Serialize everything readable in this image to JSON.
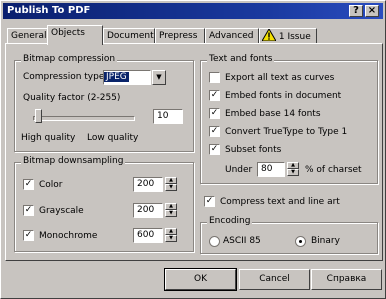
{
  "window": {
    "title": "Publish To PDF",
    "help_glyph": "?",
    "close_glyph": "×"
  },
  "tabs": [
    "General",
    "Objects",
    "Document",
    "Prepress",
    "Advanced",
    "1 Issue"
  ],
  "bitmap_compression": {
    "title": "Bitmap compression",
    "compression_type_label": "Compression type:",
    "compression_type_value": "JPEG",
    "quality_label": "Quality factor (2-255)",
    "quality_value": "10",
    "high_quality_label": "High quality",
    "low_quality_label": "Low quality",
    "slider_fraction": 0.05
  },
  "bitmap_downsampling": {
    "title": "Bitmap downsampling",
    "rows": [
      {
        "label": "Color",
        "checked": true,
        "value": "200"
      },
      {
        "label": "Grayscale",
        "checked": true,
        "value": "200"
      },
      {
        "label": "Monochrome",
        "checked": true,
        "value": "600"
      }
    ]
  },
  "text_and_fonts": {
    "title": "Text and fonts",
    "options": [
      {
        "label": "Export all text as curves",
        "checked": false
      },
      {
        "label": "Embed fonts in document",
        "checked": true
      },
      {
        "label": "Embed base 14 fonts",
        "checked": true
      },
      {
        "label": "Convert TrueType to Type 1",
        "checked": true
      },
      {
        "label": "Subset fonts",
        "checked": true
      }
    ],
    "under_label": "Under",
    "under_value": "80",
    "charset_label": "% of charset"
  },
  "compress": {
    "label": "Compress text and line art",
    "checked": true
  },
  "encoding": {
    "title": "Encoding",
    "ascii_label": "ASCII 85",
    "binary_label": "Binary",
    "selected": "Binary"
  },
  "buttons": {
    "ok": "OK",
    "cancel": "Cancel",
    "help": "Справка"
  }
}
